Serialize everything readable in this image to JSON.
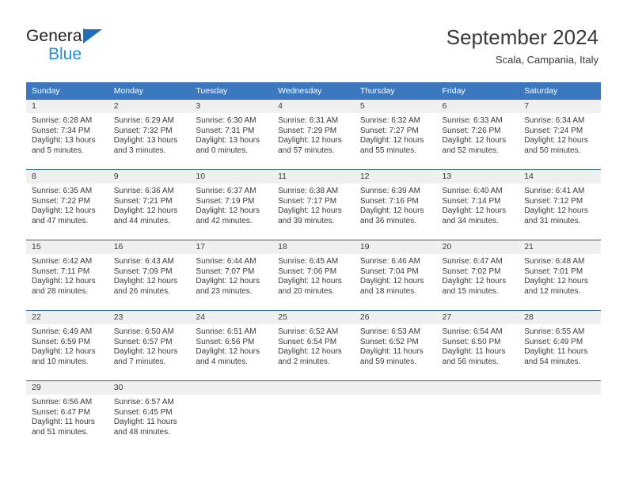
{
  "brand": {
    "name_part1": "General",
    "name_part2": "Blue",
    "triangle_icon": "blue-triangle-logo-icon",
    "color_dark": "#231f20",
    "color_blue": "#1f8fe0"
  },
  "header": {
    "title": "September 2024",
    "subtitle": "Scala, Campania, Italy"
  },
  "theme": {
    "header_row_bg": "#3c78bf",
    "header_row_text": "#ffffff",
    "row_divider": "#2a6099",
    "daynum_band_bg": "#f0f0f0",
    "cell_text": "#3a3a3a"
  },
  "calendar": {
    "columns": [
      "Sunday",
      "Monday",
      "Tuesday",
      "Wednesday",
      "Thursday",
      "Friday",
      "Saturday"
    ],
    "labels": {
      "sunrise": "Sunrise:",
      "sunset": "Sunset:",
      "daylight": "Daylight:"
    },
    "weeks": [
      [
        {
          "day": "1",
          "sunrise": "Sunrise: 6:28 AM",
          "sunset": "Sunset: 7:34 PM",
          "daylight_line1": "Daylight: 13 hours",
          "daylight_line2": "and 5 minutes."
        },
        {
          "day": "2",
          "sunrise": "Sunrise: 6:29 AM",
          "sunset": "Sunset: 7:32 PM",
          "daylight_line1": "Daylight: 13 hours",
          "daylight_line2": "and 3 minutes."
        },
        {
          "day": "3",
          "sunrise": "Sunrise: 6:30 AM",
          "sunset": "Sunset: 7:31 PM",
          "daylight_line1": "Daylight: 13 hours",
          "daylight_line2": "and 0 minutes."
        },
        {
          "day": "4",
          "sunrise": "Sunrise: 6:31 AM",
          "sunset": "Sunset: 7:29 PM",
          "daylight_line1": "Daylight: 12 hours",
          "daylight_line2": "and 57 minutes."
        },
        {
          "day": "5",
          "sunrise": "Sunrise: 6:32 AM",
          "sunset": "Sunset: 7:27 PM",
          "daylight_line1": "Daylight: 12 hours",
          "daylight_line2": "and 55 minutes."
        },
        {
          "day": "6",
          "sunrise": "Sunrise: 6:33 AM",
          "sunset": "Sunset: 7:26 PM",
          "daylight_line1": "Daylight: 12 hours",
          "daylight_line2": "and 52 minutes."
        },
        {
          "day": "7",
          "sunrise": "Sunrise: 6:34 AM",
          "sunset": "Sunset: 7:24 PM",
          "daylight_line1": "Daylight: 12 hours",
          "daylight_line2": "and 50 minutes."
        }
      ],
      [
        {
          "day": "8",
          "sunrise": "Sunrise: 6:35 AM",
          "sunset": "Sunset: 7:22 PM",
          "daylight_line1": "Daylight: 12 hours",
          "daylight_line2": "and 47 minutes."
        },
        {
          "day": "9",
          "sunrise": "Sunrise: 6:36 AM",
          "sunset": "Sunset: 7:21 PM",
          "daylight_line1": "Daylight: 12 hours",
          "daylight_line2": "and 44 minutes."
        },
        {
          "day": "10",
          "sunrise": "Sunrise: 6:37 AM",
          "sunset": "Sunset: 7:19 PM",
          "daylight_line1": "Daylight: 12 hours",
          "daylight_line2": "and 42 minutes."
        },
        {
          "day": "11",
          "sunrise": "Sunrise: 6:38 AM",
          "sunset": "Sunset: 7:17 PM",
          "daylight_line1": "Daylight: 12 hours",
          "daylight_line2": "and 39 minutes."
        },
        {
          "day": "12",
          "sunrise": "Sunrise: 6:39 AM",
          "sunset": "Sunset: 7:16 PM",
          "daylight_line1": "Daylight: 12 hours",
          "daylight_line2": "and 36 minutes."
        },
        {
          "day": "13",
          "sunrise": "Sunrise: 6:40 AM",
          "sunset": "Sunset: 7:14 PM",
          "daylight_line1": "Daylight: 12 hours",
          "daylight_line2": "and 34 minutes."
        },
        {
          "day": "14",
          "sunrise": "Sunrise: 6:41 AM",
          "sunset": "Sunset: 7:12 PM",
          "daylight_line1": "Daylight: 12 hours",
          "daylight_line2": "and 31 minutes."
        }
      ],
      [
        {
          "day": "15",
          "sunrise": "Sunrise: 6:42 AM",
          "sunset": "Sunset: 7:11 PM",
          "daylight_line1": "Daylight: 12 hours",
          "daylight_line2": "and 28 minutes."
        },
        {
          "day": "16",
          "sunrise": "Sunrise: 6:43 AM",
          "sunset": "Sunset: 7:09 PM",
          "daylight_line1": "Daylight: 12 hours",
          "daylight_line2": "and 26 minutes."
        },
        {
          "day": "17",
          "sunrise": "Sunrise: 6:44 AM",
          "sunset": "Sunset: 7:07 PM",
          "daylight_line1": "Daylight: 12 hours",
          "daylight_line2": "and 23 minutes."
        },
        {
          "day": "18",
          "sunrise": "Sunrise: 6:45 AM",
          "sunset": "Sunset: 7:06 PM",
          "daylight_line1": "Daylight: 12 hours",
          "daylight_line2": "and 20 minutes."
        },
        {
          "day": "19",
          "sunrise": "Sunrise: 6:46 AM",
          "sunset": "Sunset: 7:04 PM",
          "daylight_line1": "Daylight: 12 hours",
          "daylight_line2": "and 18 minutes."
        },
        {
          "day": "20",
          "sunrise": "Sunrise: 6:47 AM",
          "sunset": "Sunset: 7:02 PM",
          "daylight_line1": "Daylight: 12 hours",
          "daylight_line2": "and 15 minutes."
        },
        {
          "day": "21",
          "sunrise": "Sunrise: 6:48 AM",
          "sunset": "Sunset: 7:01 PM",
          "daylight_line1": "Daylight: 12 hours",
          "daylight_line2": "and 12 minutes."
        }
      ],
      [
        {
          "day": "22",
          "sunrise": "Sunrise: 6:49 AM",
          "sunset": "Sunset: 6:59 PM",
          "daylight_line1": "Daylight: 12 hours",
          "daylight_line2": "and 10 minutes."
        },
        {
          "day": "23",
          "sunrise": "Sunrise: 6:50 AM",
          "sunset": "Sunset: 6:57 PM",
          "daylight_line1": "Daylight: 12 hours",
          "daylight_line2": "and 7 minutes."
        },
        {
          "day": "24",
          "sunrise": "Sunrise: 6:51 AM",
          "sunset": "Sunset: 6:56 PM",
          "daylight_line1": "Daylight: 12 hours",
          "daylight_line2": "and 4 minutes."
        },
        {
          "day": "25",
          "sunrise": "Sunrise: 6:52 AM",
          "sunset": "Sunset: 6:54 PM",
          "daylight_line1": "Daylight: 12 hours",
          "daylight_line2": "and 2 minutes."
        },
        {
          "day": "26",
          "sunrise": "Sunrise: 6:53 AM",
          "sunset": "Sunset: 6:52 PM",
          "daylight_line1": "Daylight: 11 hours",
          "daylight_line2": "and 59 minutes."
        },
        {
          "day": "27",
          "sunrise": "Sunrise: 6:54 AM",
          "sunset": "Sunset: 6:50 PM",
          "daylight_line1": "Daylight: 11 hours",
          "daylight_line2": "and 56 minutes."
        },
        {
          "day": "28",
          "sunrise": "Sunrise: 6:55 AM",
          "sunset": "Sunset: 6:49 PM",
          "daylight_line1": "Daylight: 11 hours",
          "daylight_line2": "and 54 minutes."
        }
      ],
      [
        {
          "day": "29",
          "sunrise": "Sunrise: 6:56 AM",
          "sunset": "Sunset: 6:47 PM",
          "daylight_line1": "Daylight: 11 hours",
          "daylight_line2": "and 51 minutes."
        },
        {
          "day": "30",
          "sunrise": "Sunrise: 6:57 AM",
          "sunset": "Sunset: 6:45 PM",
          "daylight_line1": "Daylight: 11 hours",
          "daylight_line2": "and 48 minutes."
        },
        {
          "day": "",
          "sunrise": "",
          "sunset": "",
          "daylight_line1": "",
          "daylight_line2": ""
        },
        {
          "day": "",
          "sunrise": "",
          "sunset": "",
          "daylight_line1": "",
          "daylight_line2": ""
        },
        {
          "day": "",
          "sunrise": "",
          "sunset": "",
          "daylight_line1": "",
          "daylight_line2": ""
        },
        {
          "day": "",
          "sunrise": "",
          "sunset": "",
          "daylight_line1": "",
          "daylight_line2": ""
        },
        {
          "day": "",
          "sunrise": "",
          "sunset": "",
          "daylight_line1": "",
          "daylight_line2": ""
        }
      ]
    ]
  }
}
